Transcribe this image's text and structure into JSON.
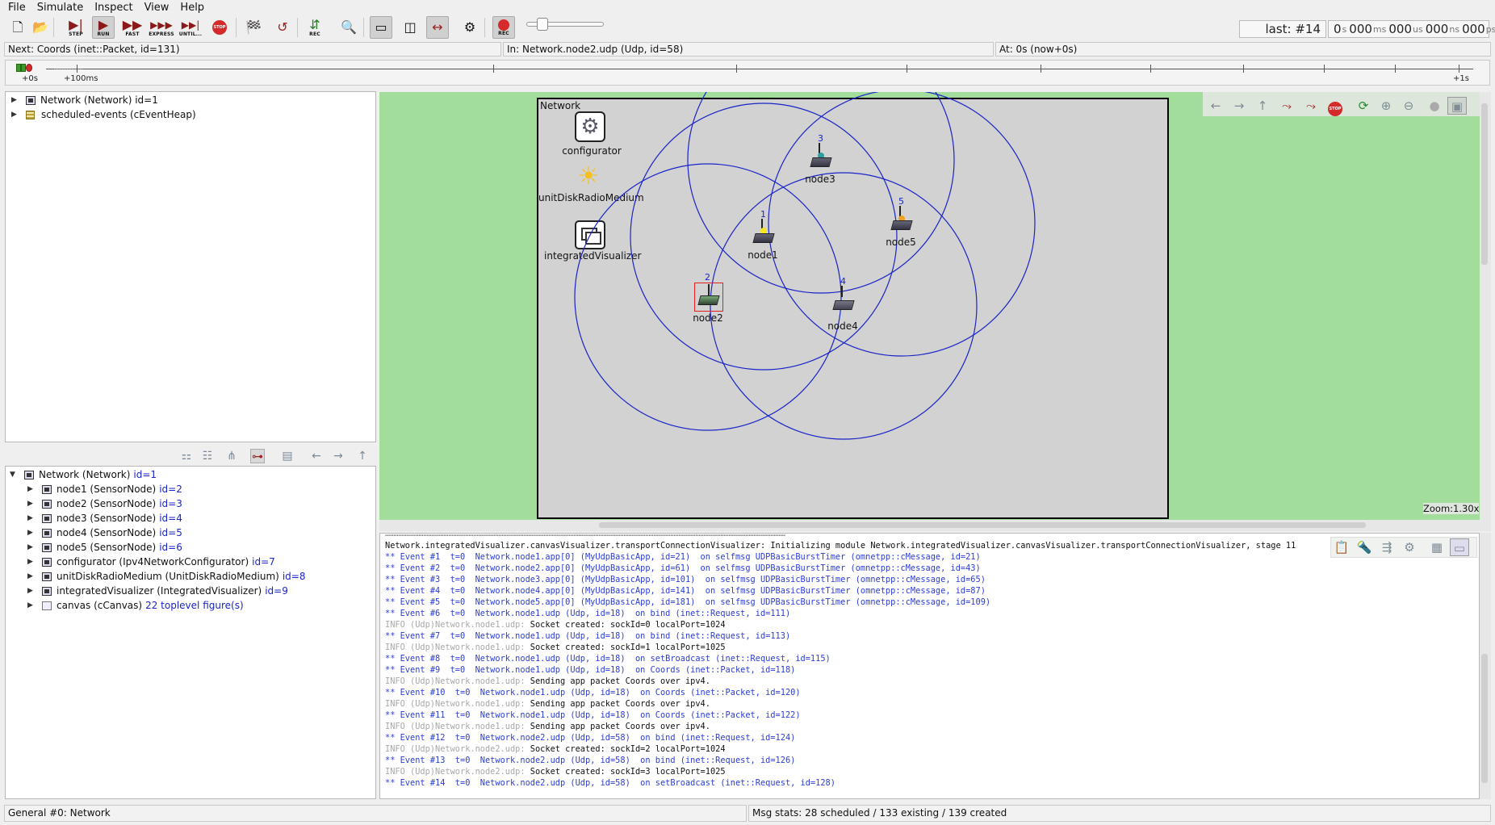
{
  "menu": [
    "File",
    "Simulate",
    "Inspect",
    "View",
    "Help"
  ],
  "toolbar": {
    "step": "STEP",
    "run": "RUN",
    "fast": "FAST",
    "express": "EXPRESS",
    "until": "UNTIL...",
    "stop": "STOP",
    "rec": "REC",
    "rec2": "REC"
  },
  "event": {
    "last": "last: #14",
    "time_s": "0",
    "s": "s",
    "time_ms": "000",
    "ms": "ms",
    "time_us": "000",
    "us": "us",
    "time_ns": "000",
    "ns": "ns",
    "time_ps": "000",
    "ps": "ps"
  },
  "info": {
    "next": "Next: Coords (inet::Packet, id=131)",
    "in": "In: Network.node2.udp (Udp, id=58)",
    "at": "At: 0s (now+0s)"
  },
  "timeline": {
    "start": "+0s",
    "t100": "+100ms",
    "end": "+1s"
  },
  "objtree": [
    {
      "label": "Network (Network) id=1"
    },
    {
      "label": "scheduled-events (cEventHeap)"
    }
  ],
  "modtree": {
    "root": {
      "label": "Network (Network)",
      "id": "id=1"
    },
    "children": [
      {
        "label": "node1 (SensorNode)",
        "id": "id=2"
      },
      {
        "label": "node2 (SensorNode)",
        "id": "id=3"
      },
      {
        "label": "node3 (SensorNode)",
        "id": "id=4"
      },
      {
        "label": "node4 (SensorNode)",
        "id": "id=5"
      },
      {
        "label": "node5 (SensorNode)",
        "id": "id=6"
      },
      {
        "label": "configurator (Ipv4NetworkConfigurator)",
        "id": "id=7"
      },
      {
        "label": "unitDiskRadioMedium (UnitDiskRadioMedium)",
        "id": "id=8"
      },
      {
        "label": "integratedVisualizer (IntegratedVisualizer)",
        "id": "id=9"
      },
      {
        "label": "canvas (cCanvas)",
        "id": "22 toplevel figure(s)"
      }
    ]
  },
  "network": {
    "title": "Network",
    "configurator": "configurator",
    "medium": "unitDiskRadioMedium",
    "visualizer": "integratedVisualizer",
    "nodes": [
      {
        "name": "node1",
        "num": "1"
      },
      {
        "name": "node2",
        "num": "2"
      },
      {
        "name": "node3",
        "num": "3"
      },
      {
        "name": "node4",
        "num": "4"
      },
      {
        "name": "node5",
        "num": "5"
      }
    ],
    "zoom": "Zoom:1.30x",
    "stop": "STOP"
  },
  "log": [
    {
      "t": "msg",
      "s": "Network.integratedVisualizer.canvasVisualizer.transportConnectionVisualizer: Initializing module Network.integratedVisualizer.canvasVisualizer.transportConnectionVisualizer, stage 11"
    },
    {
      "t": "ev",
      "s": "** Event #1  t=0  Network.node1.app[0] (MyUdpBasicApp, id=21)  on selfmsg UDPBasicBurstTimer (omnetpp::cMessage, id=21)"
    },
    {
      "t": "ev",
      "s": "** Event #2  t=0  Network.node2.app[0] (MyUdpBasicApp, id=61)  on selfmsg UDPBasicBurstTimer (omnetpp::cMessage, id=43)"
    },
    {
      "t": "ev",
      "s": "** Event #3  t=0  Network.node3.app[0] (MyUdpBasicApp, id=101)  on selfmsg UDPBasicBurstTimer (omnetpp::cMessage, id=65)"
    },
    {
      "t": "ev",
      "s": "** Event #4  t=0  Network.node4.app[0] (MyUdpBasicApp, id=141)  on selfmsg UDPBasicBurstTimer (omnetpp::cMessage, id=87)"
    },
    {
      "t": "ev",
      "s": "** Event #5  t=0  Network.node5.app[0] (MyUdpBasicApp, id=181)  on selfmsg UDPBasicBurstTimer (omnetpp::cMessage, id=109)"
    },
    {
      "t": "ev",
      "s": "** Event #6  t=0  Network.node1.udp (Udp, id=18)  on bind (inet::Request, id=111)"
    },
    {
      "t": "info",
      "p": "INFO (Udp)Network.node1.udp: ",
      "s": "Socket created: sockId=0 localPort=1024"
    },
    {
      "t": "ev",
      "s": "** Event #7  t=0  Network.node1.udp (Udp, id=18)  on bind (inet::Request, id=113)"
    },
    {
      "t": "info",
      "p": "INFO (Udp)Network.node1.udp: ",
      "s": "Socket created: sockId=1 localPort=1025"
    },
    {
      "t": "ev",
      "s": "** Event #8  t=0  Network.node1.udp (Udp, id=18)  on setBroadcast (inet::Request, id=115)"
    },
    {
      "t": "ev",
      "s": "** Event #9  t=0  Network.node1.udp (Udp, id=18)  on Coords (inet::Packet, id=118)"
    },
    {
      "t": "info",
      "p": "INFO (Udp)Network.node1.udp: ",
      "s": "Sending app packet Coords over ipv4."
    },
    {
      "t": "ev",
      "s": "** Event #10  t=0  Network.node1.udp (Udp, id=18)  on Coords (inet::Packet, id=120)"
    },
    {
      "t": "info",
      "p": "INFO (Udp)Network.node1.udp: ",
      "s": "Sending app packet Coords over ipv4."
    },
    {
      "t": "ev",
      "s": "** Event #11  t=0  Network.node1.udp (Udp, id=18)  on Coords (inet::Packet, id=122)"
    },
    {
      "t": "info",
      "p": "INFO (Udp)Network.node1.udp: ",
      "s": "Sending app packet Coords over ipv4."
    },
    {
      "t": "ev",
      "s": "** Event #12  t=0  Network.node2.udp (Udp, id=58)  on bind (inet::Request, id=124)"
    },
    {
      "t": "info",
      "p": "INFO (Udp)Network.node2.udp: ",
      "s": "Socket created: sockId=2 localPort=1024"
    },
    {
      "t": "ev",
      "s": "** Event #13  t=0  Network.node2.udp (Udp, id=58)  on bind (inet::Request, id=126)"
    },
    {
      "t": "info",
      "p": "INFO (Udp)Network.node2.udp: ",
      "s": "Socket created: sockId=3 localPort=1025"
    },
    {
      "t": "ev",
      "s": "** Event #14  t=0  Network.node2.udp (Udp, id=58)  on setBroadcast (inet::Request, id=128)"
    }
  ],
  "status": {
    "left": "General #0: Network",
    "right": "Msg stats: 28 scheduled / 133 existing / 139 created"
  },
  "colors": {
    "range": "#1a24c8",
    "playground": "#a2dd9c",
    "network": "#d2d2d2",
    "event": "#2b3dd6"
  }
}
